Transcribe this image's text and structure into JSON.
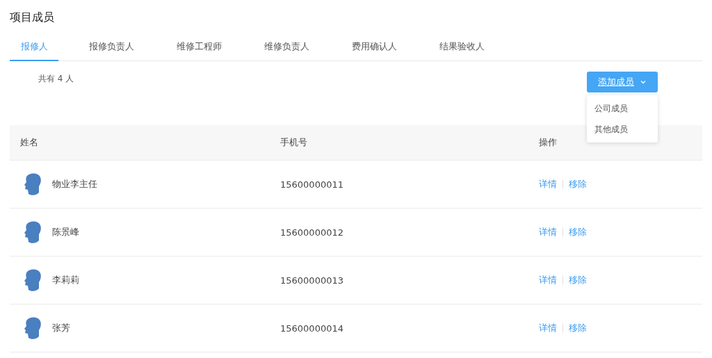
{
  "page_title": "项目成员",
  "tabs": [
    {
      "label": "报修人",
      "selected": true
    },
    {
      "label": "报修负责人",
      "selected": false
    },
    {
      "label": "维修工程师",
      "selected": false
    },
    {
      "label": "维修负责人",
      "selected": false
    },
    {
      "label": "费用确认人",
      "selected": false
    },
    {
      "label": "结果验收人",
      "selected": false
    }
  ],
  "member_count": "共有 4 人",
  "add_button": {
    "label": "添加成员",
    "expanded": true
  },
  "add_menu": [
    "公司成员",
    "其他成员"
  ],
  "table": {
    "columns": [
      "姓名",
      "手机号",
      "操作"
    ],
    "rows": [
      {
        "name": "物业李主任",
        "phone": "15600000011",
        "actions": [
          "详情",
          "移除"
        ]
      },
      {
        "name": "陈景峰",
        "phone": "15600000012",
        "actions": [
          "详情",
          "移除"
        ]
      },
      {
        "name": "李莉莉",
        "phone": "15600000013",
        "actions": [
          "详情",
          "移除"
        ]
      },
      {
        "name": "张芳",
        "phone": "15600000014",
        "actions": [
          "详情",
          "移除"
        ]
      }
    ]
  }
}
